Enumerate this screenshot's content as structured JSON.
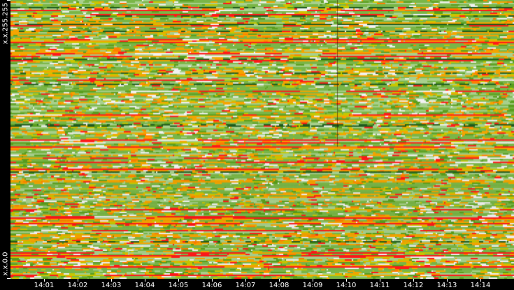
{
  "chart_data": {
    "type": "heatmap",
    "title": "",
    "xlabel": "",
    "ylabel": "",
    "y_tick_labels": [
      "x.x.255.255",
      "x.x.0.0"
    ],
    "x_tick_labels": [
      "14:01",
      "14:02",
      "14:03",
      "14:04",
      "14:05",
      "14:06",
      "14:07",
      "14:08",
      "14:09",
      "14:10",
      "14:11",
      "14:12",
      "14:13",
      "14:14"
    ],
    "x_range": [
      "14:00",
      "14:15"
    ],
    "rows": 200,
    "columns": 360,
    "color_scale": [
      "#f2f2f2",
      "#a8d08d",
      "#7ab648",
      "#5a9e1e",
      "#c8c800",
      "#f5a500",
      "#ff7f00",
      "#ff1a1a",
      "#1e5a1e"
    ],
    "grid": false,
    "legend": "none"
  }
}
